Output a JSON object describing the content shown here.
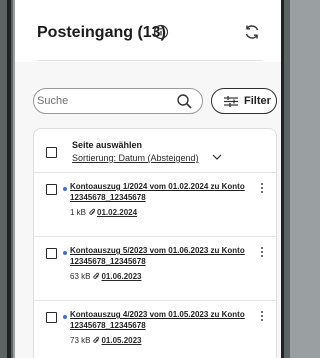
{
  "header": {
    "title": "Posteingang (13)"
  },
  "search": {
    "placeholder": "Suche"
  },
  "filter": {
    "label": "Filter"
  },
  "list": {
    "select_all_label": "Seite auswählen",
    "sort_label": "Sortierung: Datum (Absteigend)"
  },
  "messages": [
    {
      "subject": "Kontoauszug 1/2024 vom 01.02.2024 zu Konto 12345678_12345678",
      "size": "1 kB",
      "date": "01.02.2024",
      "unread": true
    },
    {
      "subject": "Kontoauszug 5/2023 vom 01.06.2023 zu Konto 12345678_12345678",
      "size": "63 kB",
      "date": "01.06.2023",
      "unread": true
    },
    {
      "subject": "Kontoauszug 4/2023 vom 01.05.2023 zu Konto 12345678_12345678",
      "size": "73 kB",
      "date": "01.05.2023",
      "unread": true
    }
  ],
  "icons": {
    "info": "info-icon",
    "refresh": "refresh-icon",
    "search": "search-icon",
    "filter": "filter-icon",
    "attachment": "paperclip-icon",
    "more": "more-vertical-icon",
    "sort": "chevron-down-icon"
  },
  "colors": {
    "unread_dot": "#3a6fd8",
    "background": "#9aa0a1"
  }
}
